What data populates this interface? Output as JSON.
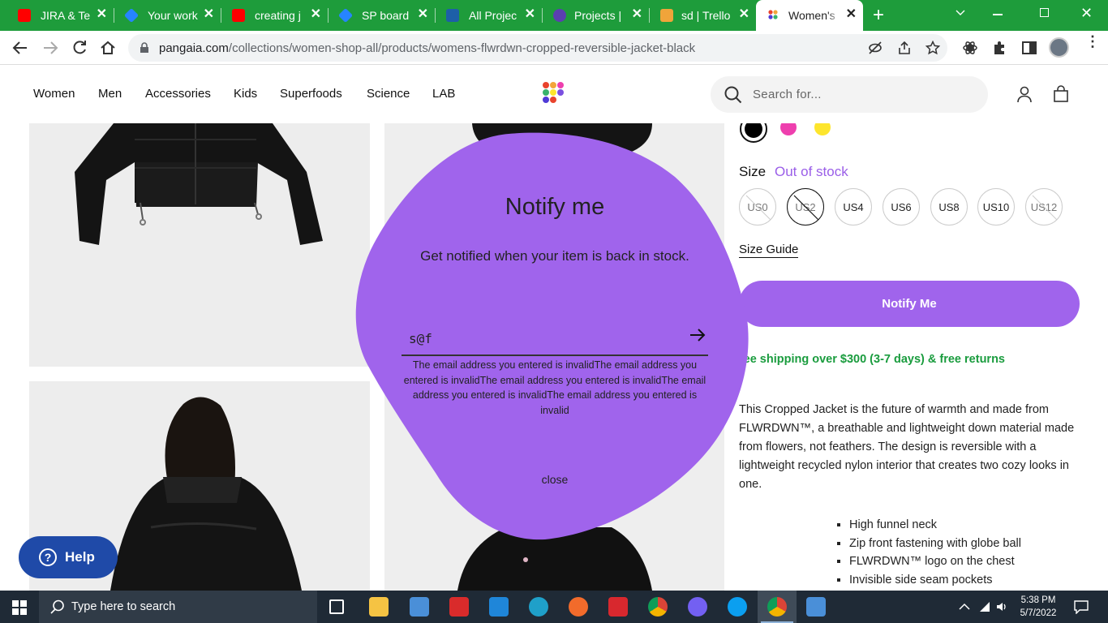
{
  "browser": {
    "tabs": [
      {
        "title": "JIRA & Te",
        "favicon_color": "#ff0000",
        "active": false
      },
      {
        "title": "Your work",
        "favicon_color": "#2684ff",
        "active": false
      },
      {
        "title": "creating j",
        "favicon_color": "#ff0000",
        "active": false
      },
      {
        "title": "SP board",
        "favicon_color": "#2684ff",
        "active": false
      },
      {
        "title": "All Projec",
        "favicon_color": "#1d5fa8",
        "active": false
      },
      {
        "title": "Projects |",
        "favicon_color": "#5b3fb0",
        "active": false
      },
      {
        "title": "sd | Trello",
        "favicon_color": "#f0a43a",
        "active": false
      },
      {
        "title": "Women's",
        "favicon_color": "#e8516a",
        "active": true
      }
    ],
    "url_host": "pangaia.com",
    "url_path": "/collections/women-shop-all/products/womens-flwrdwn-cropped-reversible-jacket-black"
  },
  "header": {
    "nav": [
      "Women",
      "Men",
      "Accessories",
      "Kids",
      "Superfoods",
      "Science",
      "LAB"
    ],
    "search_placeholder": "Search for..."
  },
  "product": {
    "swatch_colors": [
      "#000000",
      "#ee3fae",
      "#fde52d"
    ],
    "size_label": "Size",
    "stock_status": "Out of stock",
    "sizes": [
      "US0",
      "US2",
      "US4",
      "US6",
      "US8",
      "US10",
      "US12"
    ],
    "size_guide": "Size Guide",
    "notify_button": "Notify Me",
    "shipping": "ree shipping over $300 (3-7 days) & free returns",
    "description": "This Cropped Jacket is the future of warmth and made from FLWRDWN™, a breathable and lightweight down material made from flowers, not feathers. The design is reversible with a lightweight recycled nylon interior that creates two cozy looks in one.",
    "features": [
      "High funnel neck",
      "Zip front fastening with globe ball",
      "FLWRDWN™ logo on the chest",
      "Invisible side seam pockets"
    ]
  },
  "modal": {
    "title": "Notify me",
    "subtitle": "Get notified when your item is back in stock.",
    "email_value": "s@f",
    "error": "The email address you entered is invalidThe email address you entered is invalidThe email address you entered is invalidThe email address you entered is invalidThe email address you entered is invalid",
    "close_label": "close",
    "blob_color": "#a064ec"
  },
  "help_button": "Help",
  "taskbar": {
    "search_placeholder": "Type here to search",
    "time": "5:38 PM",
    "date": "5/7/2022"
  }
}
